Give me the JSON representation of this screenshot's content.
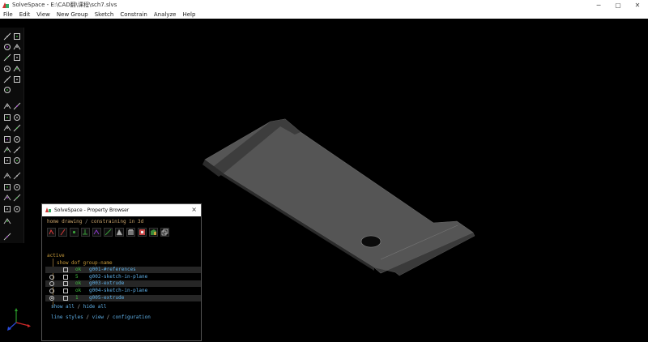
{
  "window": {
    "title": "SolveSpace - E:\\CAD翻\\课程\\sch7.slvs",
    "minimize": "─",
    "maximize": "▢",
    "close": "✕"
  },
  "menu": [
    "File",
    "Edit",
    "View",
    "New Group",
    "Sketch",
    "Constrain",
    "Analyze",
    "Help"
  ],
  "toolbar_icons": [
    "line-icon",
    "rectangle-icon",
    "circle-icon",
    "arc-icon",
    "text-icon",
    "image-icon",
    "tangent-arc-icon",
    "spline-icon",
    "point-icon",
    "workplane-icon",
    "split-icon",
    "distance-icon",
    "angle-icon",
    "horizontal-icon",
    "vertical-icon",
    "parallel-icon",
    "perpendicular-icon",
    "point-on-line-icon",
    "symmetric-icon",
    "equal-icon",
    "same-orientation-icon",
    "other-supplement-icon",
    "reference-icon",
    "extrude-icon",
    "lathe-icon",
    "revolve-icon",
    "helix-icon",
    "link-icon",
    "step-icon",
    "nearest-ortho-icon",
    "nearest-iso-icon",
    "zoom-fit-icon",
    "new-sketch-icon"
  ],
  "property_browser": {
    "title": "SolveSpace - Property Browser",
    "close": "×",
    "nav": {
      "home": "home",
      "sep": " ",
      "drawing": "drawing",
      "slash": " / ",
      "constraining": "constraining in 3d"
    },
    "section_title": "active",
    "columns": "show dof group-name",
    "groups": [
      {
        "radio": "",
        "dof": "ok",
        "name": "g001-#references",
        "highlight": true
      },
      {
        "radio": "off",
        "dof": "5",
        "name": "g002-sketch-in-plane",
        "highlight": false
      },
      {
        "radio": "off",
        "dof": "ok",
        "name": "g003-extrude",
        "highlight": true
      },
      {
        "radio": "off",
        "dof": "ok",
        "name": "g004-sketch-in-plane",
        "highlight": false
      },
      {
        "radio": "on",
        "dof": "1",
        "name": "g005-extrude",
        "highlight": true
      }
    ],
    "show_all": "show all",
    "hide_all": "hide all",
    "line_styles": "line styles",
    "view": "view",
    "configuration": "configuration",
    "link_sep": " / "
  }
}
